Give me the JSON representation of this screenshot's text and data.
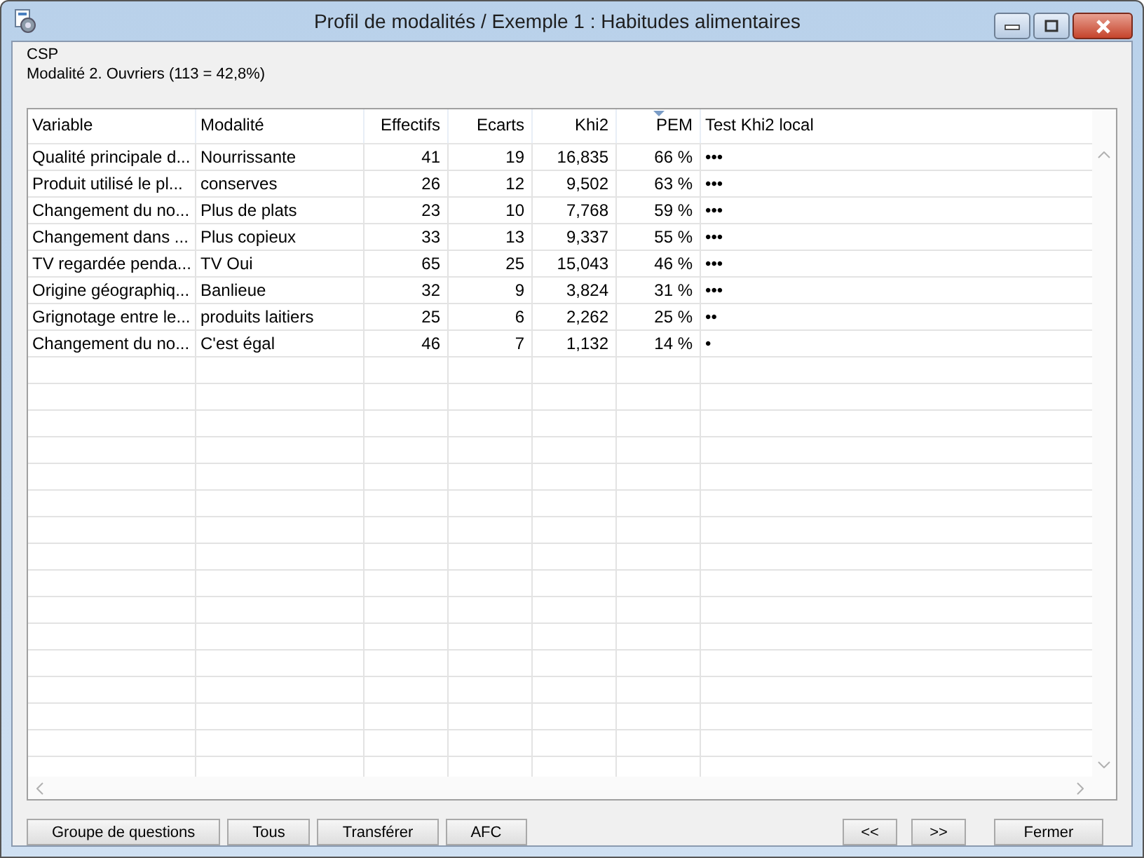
{
  "window": {
    "title": "Profil de modalités / Exemple 1 : Habitudes alimentaires"
  },
  "header": {
    "variable": "CSP",
    "modality": "Modalité 2. Ouvriers (113 = 42,8%)"
  },
  "table": {
    "columns": [
      {
        "label": "Variable",
        "sorted": false
      },
      {
        "label": "Modalité",
        "sorted": false
      },
      {
        "label": "Effectifs",
        "sorted": false
      },
      {
        "label": "Ecarts",
        "sorted": false
      },
      {
        "label": "Khi2",
        "sorted": false
      },
      {
        "label": "PEM",
        "sorted": true
      },
      {
        "label": "Test Khi2 local",
        "sorted": false
      }
    ],
    "rows": [
      [
        "Qualité principale d...",
        "Nourrissante",
        "41",
        "19",
        "16,835",
        "66 %",
        "•••"
      ],
      [
        "Produit utilisé le pl...",
        "conserves",
        "26",
        "12",
        "9,502",
        "63 %",
        "•••"
      ],
      [
        "Changement du no...",
        "Plus de plats",
        "23",
        "10",
        "7,768",
        "59 %",
        "•••"
      ],
      [
        "Changement dans ...",
        "Plus copieux",
        "33",
        "13",
        "9,337",
        "55 %",
        "•••"
      ],
      [
        "TV regardée penda...",
        "TV Oui",
        "65",
        "25",
        "15,043",
        "46 %",
        "•••"
      ],
      [
        "Origine géographiq...",
        "Banlieue",
        "32",
        "9",
        "3,824",
        "31 %",
        "•••"
      ],
      [
        "Grignotage entre le...",
        "produits laitiers",
        "25",
        "6",
        "2,262",
        "25 %",
        "••"
      ],
      [
        "Changement du no...",
        "C'est égal",
        "46",
        "7",
        "1,132",
        "14 %",
        "•"
      ]
    ]
  },
  "buttons_left": [
    "Groupe de questions",
    "Tous",
    "Transférer",
    "AFC"
  ],
  "buttons_right": [
    "<<",
    ">>",
    "Fermer"
  ]
}
